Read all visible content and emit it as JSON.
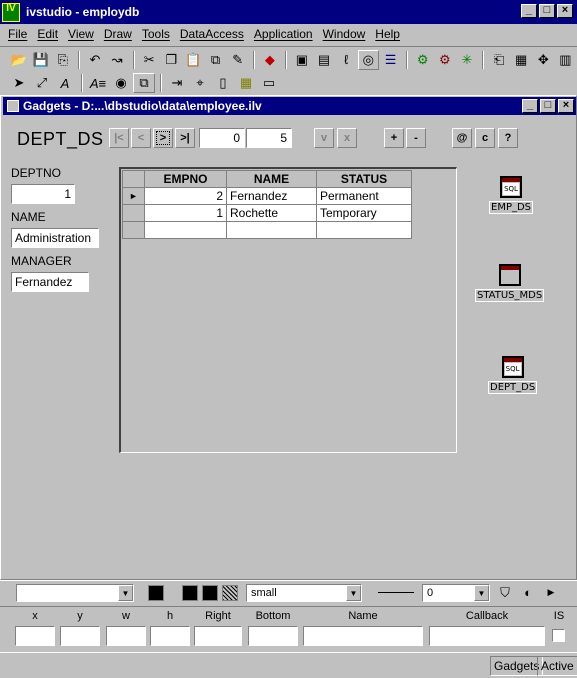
{
  "app": {
    "title": "ivstudio - employdb",
    "icon_text": "IV"
  },
  "window_buttons": {
    "minimize": "_",
    "maximize": "□",
    "close": "×"
  },
  "menu": [
    "File",
    "Edit",
    "View",
    "Draw",
    "Tools",
    "DataAccess",
    "Application",
    "Window",
    "Help"
  ],
  "child": {
    "title": "Gadgets - D:...\\dbstudio\\data\\employee.ilv"
  },
  "dept": {
    "ds_label": "DEPT_DS",
    "nav": {
      "first": "|<",
      "prev": "<",
      "next": ">",
      "last": ">|"
    },
    "row_index": "0",
    "row_count": "5",
    "btn_validate": "v",
    "btn_cancel": "x",
    "btn_insert": "+",
    "btn_delete": "-",
    "btn_at": "@",
    "btn_c": "c",
    "btn_help": "?"
  },
  "form": {
    "deptno_label": "DEPTNO",
    "deptno_value": "1",
    "name_label": "NAME",
    "name_value": "Administration",
    "manager_label": "MANAGER",
    "manager_value": "Fernandez"
  },
  "grid": {
    "columns": [
      "EMPNO",
      "NAME",
      "STATUS"
    ],
    "rows": [
      {
        "marker": "►",
        "empno": "2",
        "name": "Fernandez",
        "status": "Permanent"
      },
      {
        "marker": "",
        "empno": "1",
        "name": "Rochette",
        "status": "Temporary"
      }
    ]
  },
  "data_sources": [
    {
      "label": "EMP_DS",
      "icon": "sql-datasource-icon",
      "glyph": "SQL"
    },
    {
      "label": "STATUS_MDS",
      "icon": "memory-datasource-icon",
      "glyph": ""
    },
    {
      "label": "DEPT_DS",
      "icon": "sql-datasource-icon",
      "glyph": "SQL"
    }
  ],
  "props_bar": {
    "font_combo": "",
    "font_size": "small",
    "line_width": "0"
  },
  "inspector": {
    "labels": {
      "x": "x",
      "y": "y",
      "w": "w",
      "h": "h",
      "right": "Right",
      "bottom": "Bottom",
      "name": "Name",
      "callback": "Callback",
      "is": "IS"
    }
  },
  "status": {
    "panel1": "Gadgets",
    "panel2": "Active"
  }
}
